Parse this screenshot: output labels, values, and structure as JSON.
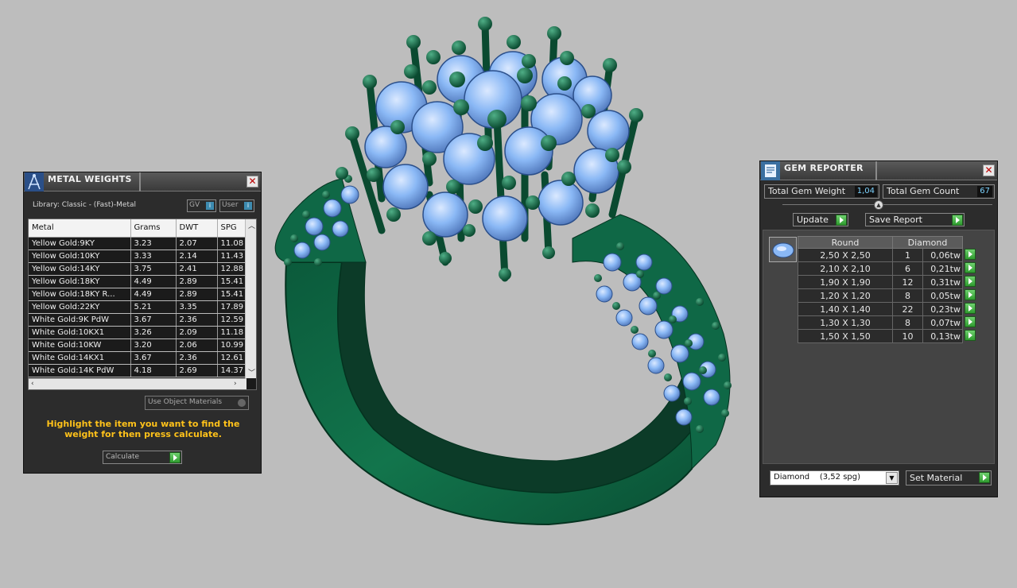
{
  "metal_weights": {
    "title": "METAL WEIGHTS",
    "library": "Library: Classic - (Fast)-Metal",
    "toggle_gv": "GV",
    "toggle_user": "User",
    "columns": [
      "Metal",
      "Grams",
      "DWT",
      "SPG"
    ],
    "rows": [
      [
        "Yellow Gold:9KY",
        "3.23",
        "2.07",
        "11.08"
      ],
      [
        "Yellow Gold:10KY",
        "3.33",
        "2.14",
        "11.43"
      ],
      [
        "Yellow Gold:14KY",
        "3.75",
        "2.41",
        "12.88"
      ],
      [
        "Yellow Gold:18KY",
        "4.49",
        "2.89",
        "15.41"
      ],
      [
        "Yellow Gold:18KY R...",
        "4.49",
        "2.89",
        "15.41"
      ],
      [
        "Yellow Gold:22KY",
        "5.21",
        "3.35",
        "17.89"
      ],
      [
        "White Gold:9K PdW",
        "3.67",
        "2.36",
        "12.59"
      ],
      [
        "White Gold:10KX1",
        "3.26",
        "2.09",
        "11.18"
      ],
      [
        "White Gold:10KW",
        "3.20",
        "2.06",
        "10.99"
      ],
      [
        "White Gold:14KX1",
        "3.67",
        "2.36",
        "12.61"
      ],
      [
        "White Gold:14K PdW",
        "4.18",
        "2.69",
        "14.37"
      ]
    ],
    "use_object_materials": "Use Object Materials",
    "hint": "Highlight the item you want to find the weight for then press calculate.",
    "calculate": "Calculate"
  },
  "gem_reporter": {
    "title": "GEM REPORTER",
    "total_weight_label": "Total Gem Weight",
    "total_weight_value": "1,04",
    "total_count_label": "Total Gem Count",
    "total_count_value": "67",
    "update": "Update",
    "save_report": "Save Report",
    "shape": "Round",
    "material": "Diamond",
    "gems": [
      {
        "size": "2,50 X 2,50",
        "count": "1",
        "weight": "0,06tw"
      },
      {
        "size": "2,10 X 2,10",
        "count": "6",
        "weight": "0,21tw"
      },
      {
        "size": "1,90 X 1,90",
        "count": "12",
        "weight": "0,31tw"
      },
      {
        "size": "1,20 X 1,20",
        "count": "8",
        "weight": "0,05tw"
      },
      {
        "size": "1,40 X 1,40",
        "count": "22",
        "weight": "0,23tw"
      },
      {
        "size": "1,30 X 1,30",
        "count": "8",
        "weight": "0,07tw"
      },
      {
        "size": "1,50 X 1,50",
        "count": "10",
        "weight": "0,13tw"
      }
    ],
    "material_select": "Diamond    (3,52 spg)",
    "set_material": "Set Material"
  },
  "colors": {
    "viewport": "#bdbdbd",
    "metal": "#0e6b45",
    "gem": "#8ab8f5",
    "hint": "#ffc21a"
  }
}
